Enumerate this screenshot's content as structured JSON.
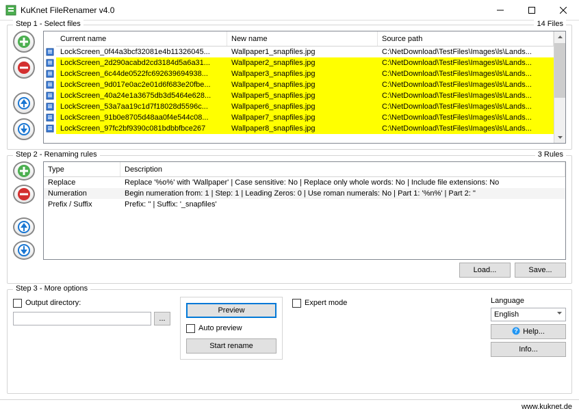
{
  "window": {
    "title": "KuKnet FileRenamer v4.0"
  },
  "step1": {
    "label": "Step 1 - Select files",
    "count": "14 Files",
    "headers": {
      "current": "Current name",
      "newname": "New name",
      "source": "Source path"
    },
    "rows": [
      {
        "hl": false,
        "current": "LockScreen_0f44a3bcf32081e4b11326045...",
        "newname": "Wallpaper1_snapfiles.jpg",
        "source": "C:\\NetDownload\\TestFiles\\Images\\ls\\Lands..."
      },
      {
        "hl": true,
        "current": "LockScreen_2d290acabd2cd3184d5a6a31...",
        "newname": "Wallpaper2_snapfiles.jpg",
        "source": "C:\\NetDownload\\TestFiles\\Images\\ls\\Lands..."
      },
      {
        "hl": true,
        "current": "LockScreen_6c44de0522fc692639694938...",
        "newname": "Wallpaper3_snapfiles.jpg",
        "source": "C:\\NetDownload\\TestFiles\\Images\\ls\\Lands..."
      },
      {
        "hl": true,
        "current": "LockScreen_9d017e0ac2e01d6f683e20fbe...",
        "newname": "Wallpaper4_snapfiles.jpg",
        "source": "C:\\NetDownload\\TestFiles\\Images\\ls\\Lands..."
      },
      {
        "hl": true,
        "current": "LockScreen_40a24e1a3675db3d5464e628...",
        "newname": "Wallpaper5_snapfiles.jpg",
        "source": "C:\\NetDownload\\TestFiles\\Images\\ls\\Lands..."
      },
      {
        "hl": true,
        "current": "LockScreen_53a7aa19c1d7f18028d5596c...",
        "newname": "Wallpaper6_snapfiles.jpg",
        "source": "C:\\NetDownload\\TestFiles\\Images\\ls\\Lands..."
      },
      {
        "hl": true,
        "current": "LockScreen_91b0e8705d48aa0f4e544c08...",
        "newname": "Wallpaper7_snapfiles.jpg",
        "source": "C:\\NetDownload\\TestFiles\\Images\\ls\\Lands..."
      },
      {
        "hl": true,
        "current": "LockScreen_97fc2bf9390c081bdbbfbce267",
        "newname": "Wallpaper8_snapfiles.jpg",
        "source": "C:\\NetDownload\\TestFiles\\Images\\ls\\Lands..."
      }
    ]
  },
  "step2": {
    "label": "Step 2 - Renaming rules",
    "count": "3 Rules",
    "headers": {
      "type": "Type",
      "desc": "Description"
    },
    "rows": [
      {
        "type": "Replace",
        "desc": "Replace '%o%' with 'Wallpaper' | Case sensitive: No | Replace only whole words: No | Include file extensions: No"
      },
      {
        "type": "Numeration",
        "desc": "Begin numeration from: 1 | Step: 1 | Leading Zeros: 0 | Use roman numerals: No | Part 1: '%n%' | Part 2: ''"
      },
      {
        "type": "Prefix / Suffix",
        "desc": "Prefix: '' | Suffix: '_snapfiles'"
      }
    ],
    "load": "Load...",
    "save": "Save..."
  },
  "step3": {
    "label": "Step 3 - More options",
    "output_dir_label": "Output directory:",
    "browse": "...",
    "preview": "Preview",
    "auto_preview": "Auto preview",
    "start_rename": "Start rename",
    "expert_mode": "Expert mode",
    "language_label": "Language",
    "language_value": "English",
    "help": "Help...",
    "info": "Info..."
  },
  "statusbar": {
    "url": "www.kuknet.de"
  }
}
